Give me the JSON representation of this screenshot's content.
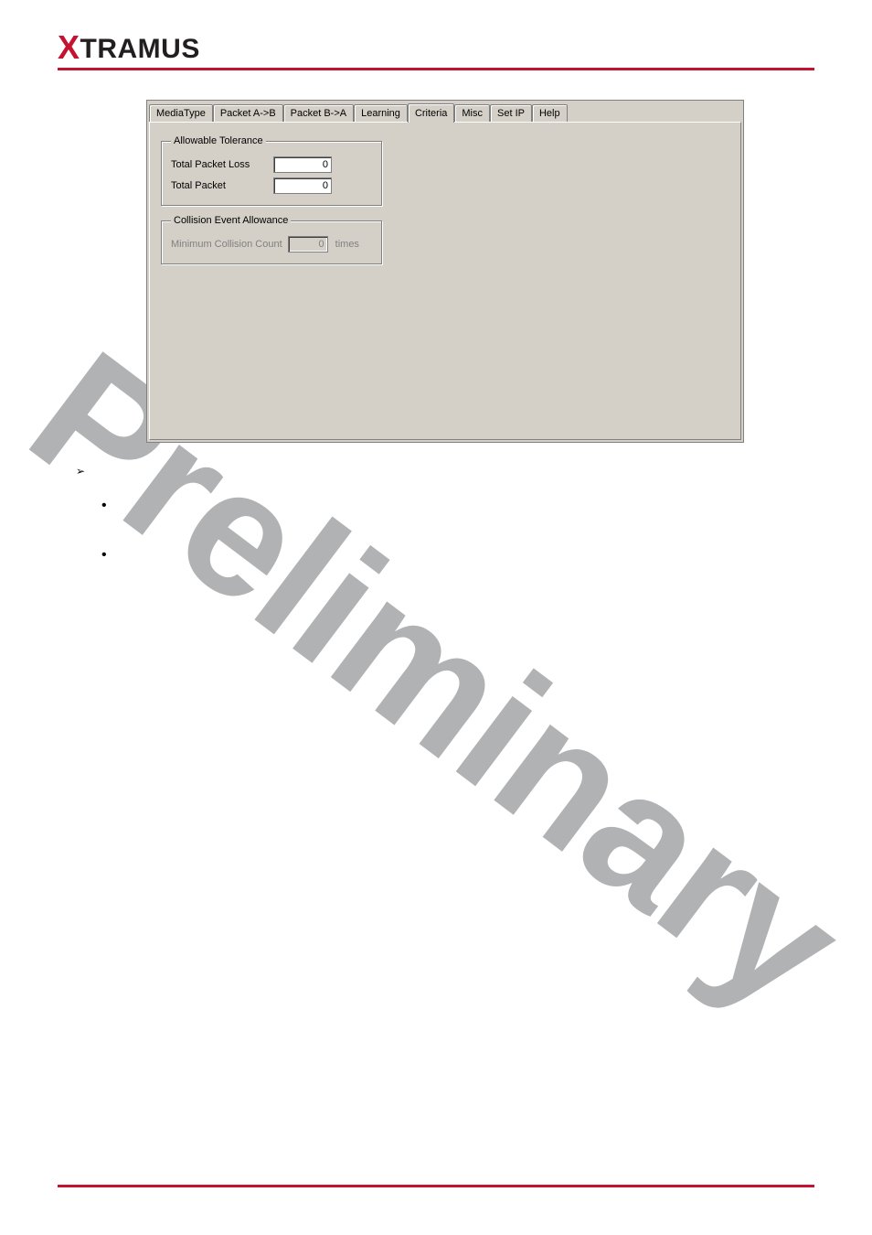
{
  "logo": {
    "prefix": "X",
    "rest": "TRAMUS"
  },
  "tabs": {
    "items": [
      {
        "label": "MediaType"
      },
      {
        "label": "Packet A->B"
      },
      {
        "label": "Packet B->A"
      },
      {
        "label": "Learning"
      },
      {
        "label": "Criteria"
      },
      {
        "label": "Misc"
      },
      {
        "label": "Set IP"
      },
      {
        "label": "Help"
      }
    ],
    "activeIndex": 4
  },
  "allowable_tolerance": {
    "legend": "Allowable Tolerance",
    "total_packet_loss_label": "Total Packet Loss",
    "total_packet_loss_value": "0",
    "total_packet_label": "Total Packet",
    "total_packet_value": "0"
  },
  "collision": {
    "legend": "Collision Event Allowance",
    "min_label": "Minimum Collision Count",
    "min_value": "0",
    "unit": "times"
  },
  "watermark": "Preliminary"
}
